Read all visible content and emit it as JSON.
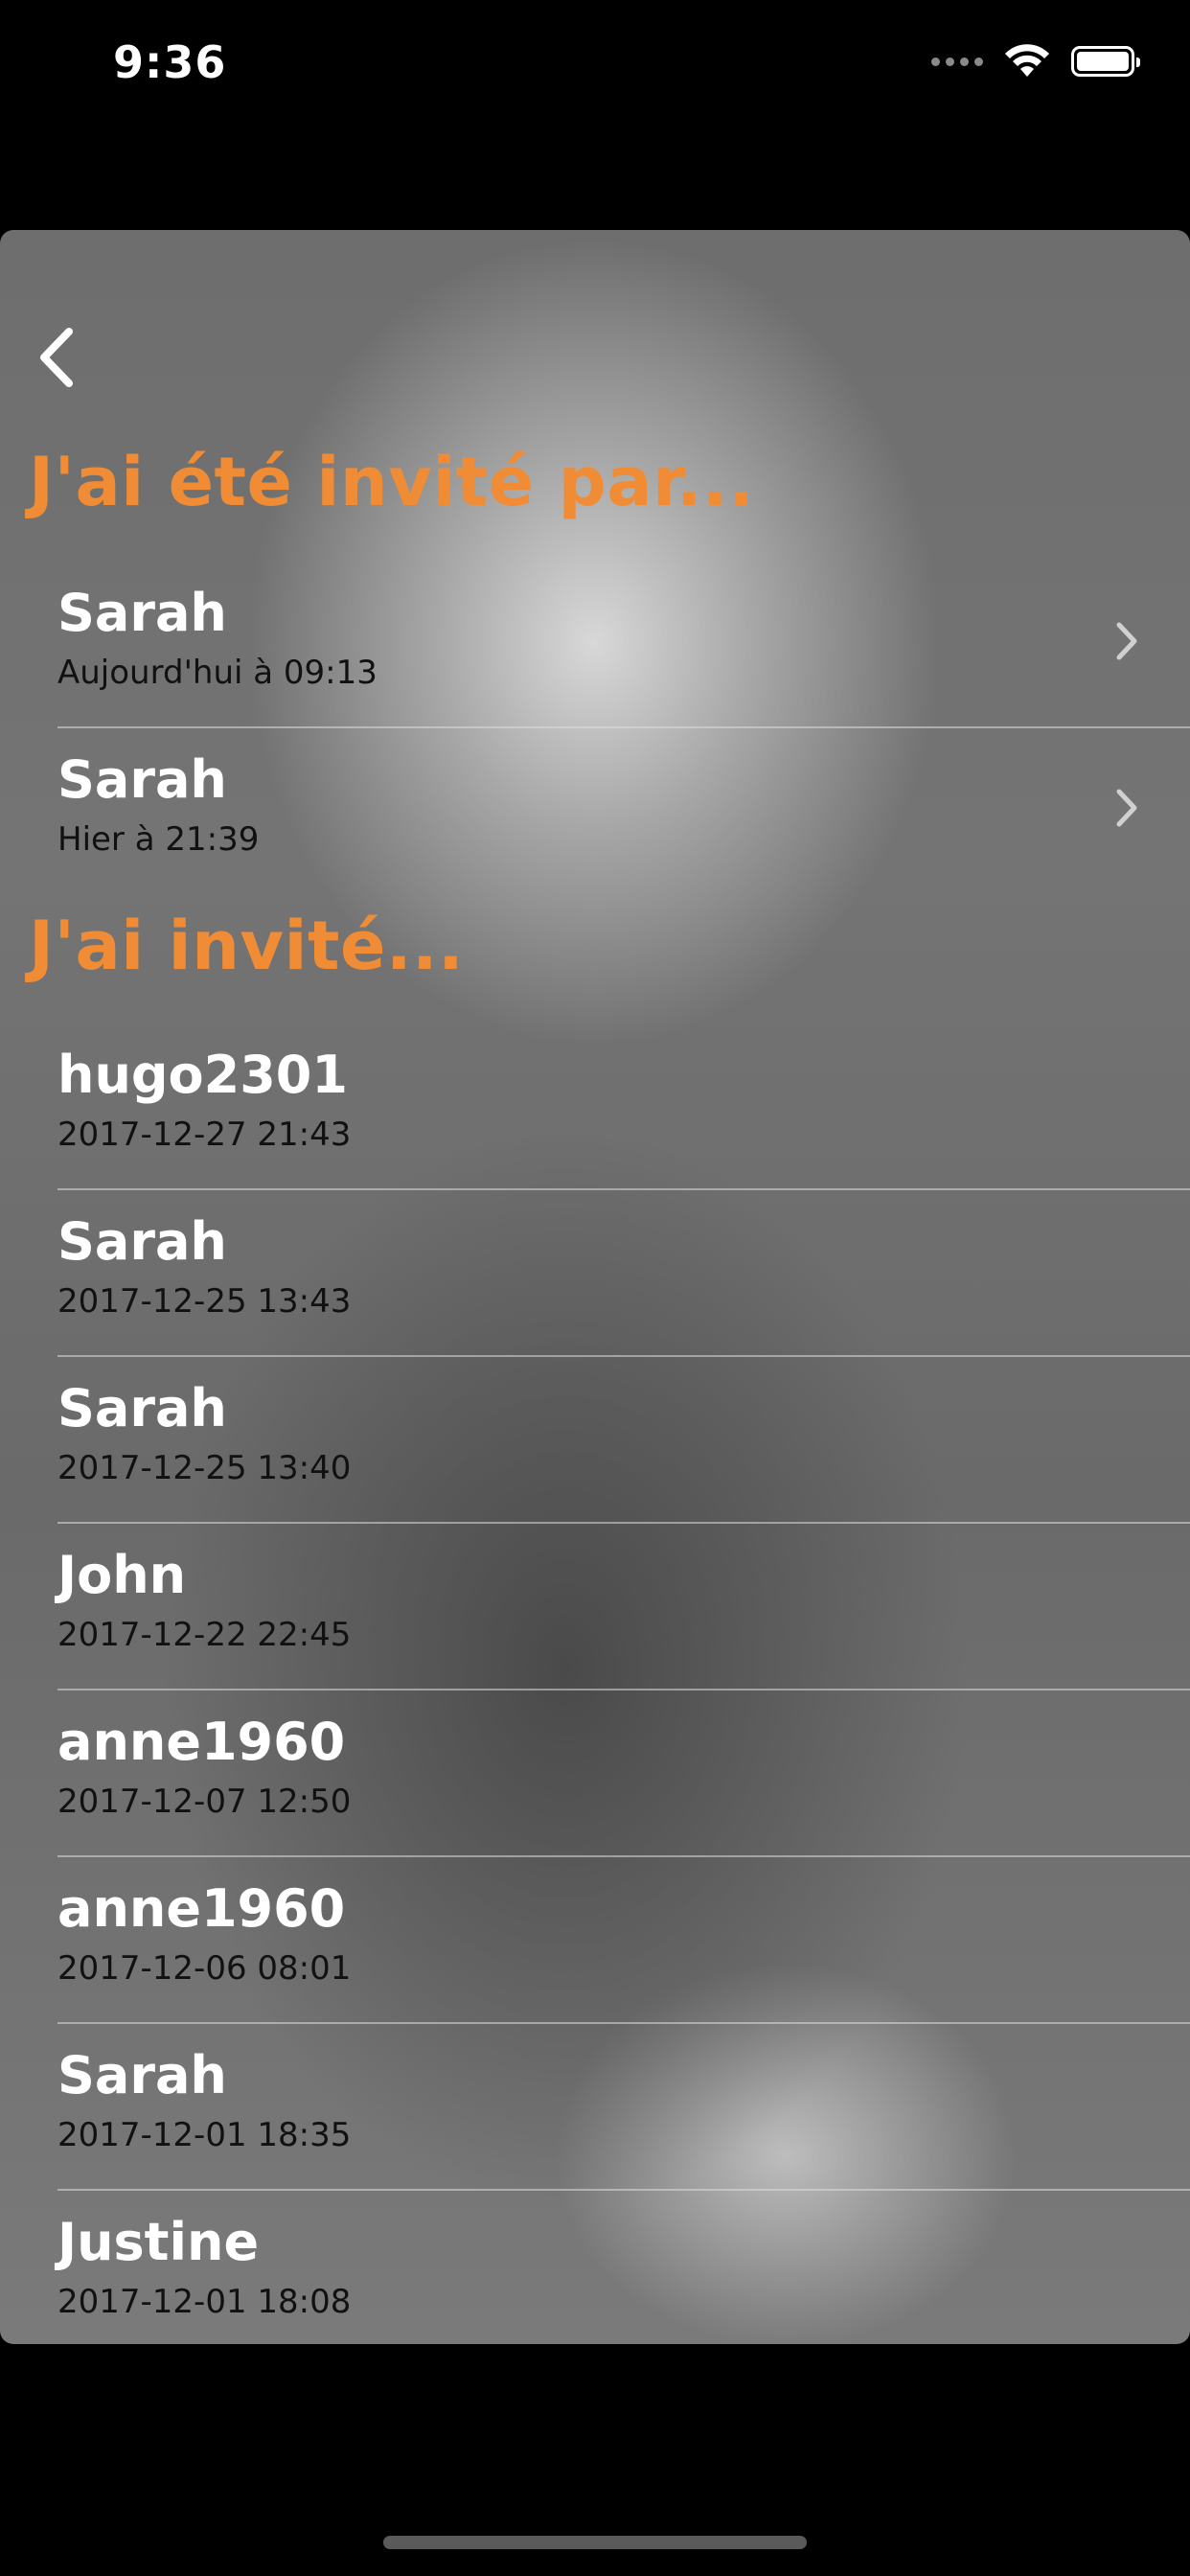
{
  "status_bar": {
    "time": "9:36"
  },
  "header": {
    "back_icon": "chevron-left-icon"
  },
  "invited_by": {
    "title": "J'ai été invité par...",
    "items": [
      {
        "name": "Sarah",
        "date": "Aujourd'hui à 09:13"
      },
      {
        "name": "Sarah",
        "date": "Hier à 21:39"
      }
    ]
  },
  "i_invited": {
    "title": "J'ai invité...",
    "items": [
      {
        "name": "hugo2301",
        "date": "2017-12-27 21:43"
      },
      {
        "name": "Sarah",
        "date": "2017-12-25 13:43"
      },
      {
        "name": "Sarah",
        "date": "2017-12-25 13:40"
      },
      {
        "name": "John",
        "date": "2017-12-22 22:45"
      },
      {
        "name": "anne1960",
        "date": "2017-12-07 12:50"
      },
      {
        "name": "anne1960",
        "date": "2017-12-06 08:01"
      },
      {
        "name": "Sarah",
        "date": "2017-12-01 18:35"
      },
      {
        "name": "Justine",
        "date": "2017-12-01 18:08"
      }
    ]
  },
  "colors": {
    "accent": "#f08c35"
  }
}
